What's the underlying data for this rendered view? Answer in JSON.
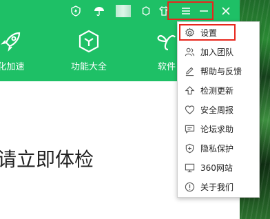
{
  "features": [
    {
      "icon": "rocket-icon",
      "label": "化加速"
    },
    {
      "icon": "cube-icon",
      "label": "功能大全"
    },
    {
      "icon": "software-icon",
      "label": "软件"
    }
  ],
  "title_icons": [
    "shield-bolt-icon",
    "umbrella-icon",
    "avatar",
    "gear-icon",
    "shirt-icon",
    "menu-icon",
    "minimize-icon",
    "close-icon"
  ],
  "main": {
    "text": "请立即体检"
  },
  "menu": {
    "items": [
      {
        "icon": "gear-icon",
        "label": "设置"
      },
      {
        "icon": "users-icon",
        "label": "加入团队"
      },
      {
        "icon": "pencil-icon",
        "label": "帮助与反馈"
      },
      {
        "icon": "upload-icon",
        "label": "检测更新"
      },
      {
        "icon": "heart-icon",
        "label": "安全周报"
      },
      {
        "icon": "forum-icon",
        "label": "论坛求助"
      },
      {
        "icon": "shield-plus-icon",
        "label": "隐私保护"
      },
      {
        "icon": "monitor-icon",
        "label": "360网站"
      },
      {
        "icon": "info-icon",
        "label": "关于我们"
      }
    ]
  },
  "colors": {
    "brand_green": "#1ec066",
    "highlight_red": "#e8261c"
  }
}
